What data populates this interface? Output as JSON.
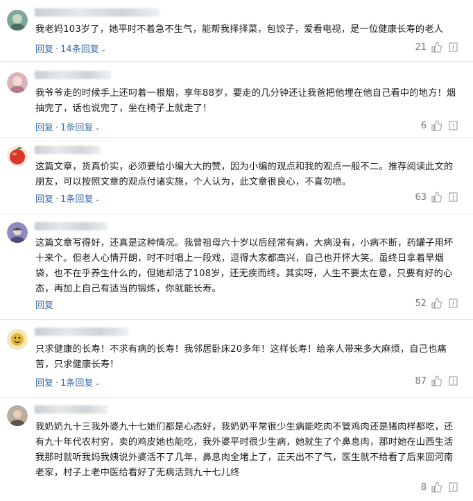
{
  "comments": [
    {
      "text": "我老妈103岁了，她平时不着急不生气，能帮我择择菜，包饺子，爱看电视，是一位健康长寿的老人",
      "reply_label": "回复",
      "reply_count": "14条回复",
      "likes": "21",
      "avatar_color": "#6c8f8a"
    },
    {
      "text": "我爷爷走的时候手上还叼着一根烟，享年88岁，要走的几分钟还让我爸把他埋在他自己看中的地方！烟抽完了，话也说完了，坐在椅子上就走了！",
      "reply_label": "回复",
      "reply_count": "1条回复",
      "likes": "6",
      "avatar_color": "#c7a2ae"
    },
    {
      "text": "这篇文章，货真价实，必须要给小编大大的赞，因为小编的观点和我的观点一般不二。推荐阅读此文的朋友，可以按照文章的观点付诸实施，个人认为，此文章很良心，不喜勿喷。",
      "reply_label": "回复",
      "reply_count": "1条回复",
      "likes": "63",
      "avatar_color": "#d9372b"
    },
    {
      "text": "这篇文章写得好，还真是这种情况。我曾祖母六十岁以后经常有病，大病没有，小病不断，药罐子用坏十来个。但老人心情开朗，时不时唱上一段戏，逗得大家都高兴，自己也开怀大笑。虽终日拿着旱烟袋，也不在乎养生什么的，但她却活了108岁，还无疾而终。其实呀，人生不要太在意，只要有好的心态，再加上自己有适当的锻炼，你就能长寿。",
      "reply_label": "回复",
      "reply_count": "",
      "likes": "52",
      "avatar_color": "#7a78a8"
    },
    {
      "text": "只求健康的长寿！不求有病的长寿！我邻居卧床20多年！这样长寿！给亲人带来多大麻烦，自己也痛苦，只求健康长寿！",
      "reply_label": "回复",
      "reply_count": "1条回复",
      "likes": "87",
      "avatar_color": "#e8c65a"
    },
    {
      "text": "我奶奶九十三我外婆九十七她们都是心态好，我奶奶平常很少生病能吃肉不管鸡肉还是猪肉样都吃，还有九十年代农村穷，卖的鸡皮她也能吃，我外婆平时很少生病，她就生了个鼻息肉，那时她在山西生活我那时就听我妈我姨说外婆活不了几年，鼻息肉全堵上了，正天出不了气，医生就不给看了后来回河南老家，村子上老中医给看好了无病活到九十七儿终",
      "reply_label": "",
      "reply_count": "",
      "likes": "8",
      "avatar_color": "#8a7a6a"
    }
  ],
  "icons": {
    "like": "thumbs-up-icon",
    "report": "flag-icon",
    "expand": "chevron-down-icon"
  }
}
